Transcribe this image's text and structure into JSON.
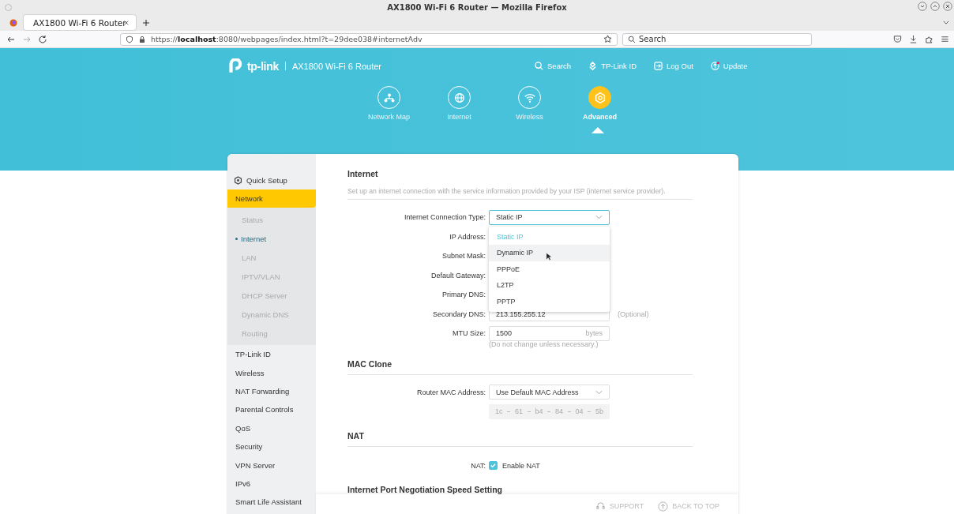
{
  "window": {
    "title": "AX1800 Wi-Fi 6 Router — Mozilla Firefox"
  },
  "tabs": [
    {
      "label": "AX1800 Wi-Fi 6 Router",
      "selected": true
    }
  ],
  "url_bar": {
    "address": "https://**localhost**:8080/webpages/index.html?t=29dee038#internetAdv",
    "search_placeholder": "Search"
  },
  "header": {
    "brand": "tp-link",
    "model": "AX1800 Wi-Fi 6 Router",
    "actions": [
      {
        "kind": "search",
        "label": "Search"
      },
      {
        "kind": "id",
        "label": "TP-Link ID"
      },
      {
        "kind": "logout",
        "label": "Log Out"
      },
      {
        "kind": "update",
        "label": "Update"
      }
    ],
    "nav": [
      {
        "kind": "map",
        "label": "Network Map",
        "selected": false
      },
      {
        "kind": "globe",
        "label": "Internet",
        "selected": false
      },
      {
        "kind": "wifi",
        "label": "Wireless",
        "selected": false
      },
      {
        "kind": "gear",
        "label": "Advanced",
        "selected": true
      }
    ]
  },
  "sidebar": {
    "quick_setup": "Quick Setup",
    "items": [
      {
        "label": "Network",
        "selected": true,
        "children": [
          {
            "label": "Status",
            "selected": false
          },
          {
            "label": "Internet",
            "selected": true
          },
          {
            "label": "LAN",
            "selected": false
          },
          {
            "label": "IPTV/VLAN",
            "selected": false
          },
          {
            "label": "DHCP Server",
            "selected": false
          },
          {
            "label": "Dynamic DNS",
            "selected": false
          },
          {
            "label": "Routing",
            "selected": false
          }
        ]
      },
      {
        "label": "TP-Link ID",
        "selected": false
      },
      {
        "label": "Wireless",
        "selected": false
      },
      {
        "label": "NAT Forwarding",
        "selected": false
      },
      {
        "label": "Parental Controls",
        "selected": false
      },
      {
        "label": "QoS",
        "selected": false
      },
      {
        "label": "Security",
        "selected": false
      },
      {
        "label": "VPN Server",
        "selected": false
      },
      {
        "label": "IPv6",
        "selected": false
      },
      {
        "label": "Smart Life Assistant",
        "selected": false
      }
    ]
  },
  "internet": {
    "title": "Internet",
    "description": "Set up an internet connection with the service information provided by your ISP (internet service provider).",
    "connection_type": {
      "label": "Internet Connection Type:",
      "value": "Static IP",
      "expanded": true,
      "options": [
        {
          "label": "Static IP",
          "selected": true,
          "hovered": false
        },
        {
          "label": "Dynamic IP",
          "selected": false,
          "hovered": true
        },
        {
          "label": "PPPoE",
          "selected": false,
          "hovered": false
        },
        {
          "label": "L2TP",
          "selected": false,
          "hovered": false
        },
        {
          "label": "PPTP",
          "selected": false,
          "hovered": false
        }
      ]
    },
    "fields": [
      {
        "label": "IP Address:"
      },
      {
        "label": "Subnet Mask:"
      },
      {
        "label": "Default Gateway:"
      },
      {
        "label": "Primary DNS:"
      },
      {
        "label": "Secondary DNS:",
        "value": "213.155.255.12",
        "note": "(Optional)"
      },
      {
        "label": "MTU Size:",
        "value": "1500",
        "unit": "bytes",
        "hint": "(Do not change unless necessary.)"
      }
    ]
  },
  "mac_clone": {
    "title": "MAC Clone",
    "label": "Router MAC Address:",
    "value": "Use Default MAC Address",
    "octets": [
      "1c",
      "61",
      "b4",
      "84",
      "04",
      "5b"
    ]
  },
  "nat": {
    "title": "NAT",
    "label": "NAT:",
    "checkbox": "Enable NAT",
    "checked": true
  },
  "port_speed": {
    "title": "Internet Port Negotiation Speed Setting"
  },
  "footer": {
    "support": "SUPPORT",
    "back_to_top": "BACK TO TOP"
  }
}
